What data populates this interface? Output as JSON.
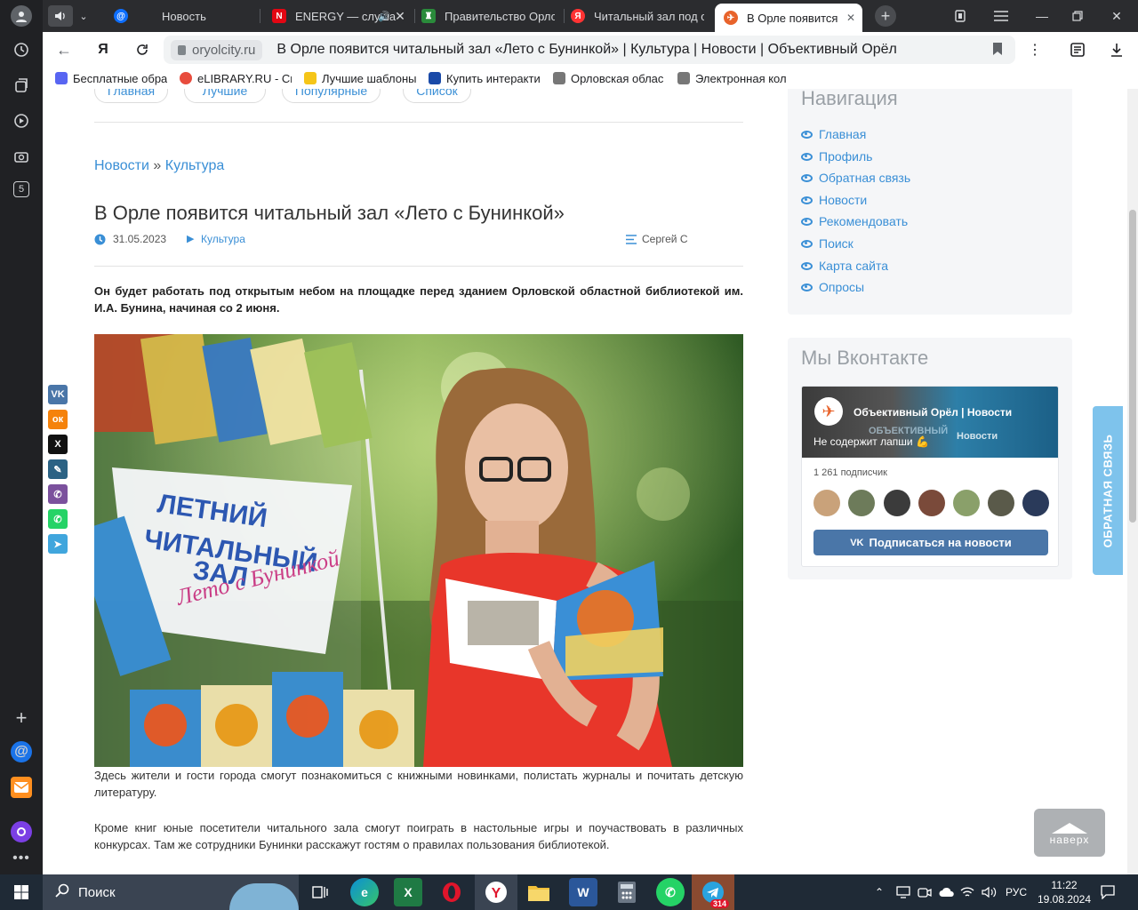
{
  "browser": {
    "tabs": [
      {
        "title": "Новость",
        "favicon_color": "#0d6efd"
      },
      {
        "title": "ENERGY — слуша",
        "favicon_color": "#e30613"
      },
      {
        "title": "Правительство Орло",
        "favicon_color": "#2a8b3b"
      },
      {
        "title": "Читальный зал под от",
        "favicon_color": "#ff3333"
      },
      {
        "title": "В Орле появится ч",
        "favicon_color": "#e8632b",
        "active": true
      }
    ],
    "address": {
      "domain": "oryolcity.ru",
      "title": "В Орле появится читальный зал «Лето с Бунинкой» | Культура | Новости | Объективный Орёл"
    },
    "bookmarks": [
      {
        "label": "Бесплатные обра",
        "color": "#5865f2"
      },
      {
        "label": "eLIBRARY.RU - Св",
        "color": "#e84c3d"
      },
      {
        "label": "Лучшие шаблоны",
        "color": "#f5c518"
      },
      {
        "label": "Купить интеракти",
        "color": "#1a4aa8"
      },
      {
        "label": "Орловская облас",
        "color": "#777777"
      },
      {
        "label": "Электронная кол",
        "color": "#777777"
      }
    ]
  },
  "site": {
    "menu_pills": [
      "Главная",
      "Лучшие",
      "Популярные",
      "Список"
    ],
    "breadcrumb": {
      "first": "Новости",
      "separator": "»",
      "second": "Культура"
    },
    "article": {
      "title": "В Орле появится читальный зал «Лето с Бунинкой»",
      "date": "31.05.2023",
      "category": "Культура",
      "author": "Сергей С",
      "lead": "Он будет работать под открытым небом на площадке перед зданием Орловской областной библиотекой им. И.А. Бунина, начиная со 2 июня.",
      "photo_sign_lines": [
        "ЛЕТНИЙ",
        "ЧИТАЛЬНЫЙ",
        "ЗАЛ",
        "Лето с Бунинкой"
      ],
      "paragraphs": [
        "Здесь жители и гости города смогут познакомиться с книжными новинками, полистать журналы и почитать детскую литературу.",
        "Кроме книг юные посетители читального зала смогут поиграть в настольные игры и поучаствовать в различных конкурсах. Там же сотрудники Бунинки расскажут гостям о правилах пользования библиотекой."
      ]
    },
    "sidebar": {
      "nav_title": "Навигация",
      "nav_items": [
        "Главная",
        "Профиль",
        "Обратная связь",
        "Новости",
        "Рекомендовать",
        "Поиск",
        "Карта сайта",
        "Опросы"
      ],
      "vk_title": "Мы Вконтакте",
      "vk_widget": {
        "group_name": "Объективный Орёл | Новости",
        "status": "Не содержит лапши 💪",
        "cover_text": "ОБЪЕКТИВНЫЙ",
        "cover_sub": "Новости",
        "subscribers": "1 261 подписчик",
        "subscribe_button": "Подписаться на новости"
      }
    },
    "share": [
      {
        "name": "vk",
        "glyph": "VK",
        "color": "#4a76a8"
      },
      {
        "name": "ok",
        "glyph": "ок",
        "color": "#f5820b"
      },
      {
        "name": "x",
        "glyph": "X",
        "color": "#111111"
      },
      {
        "name": "lj",
        "glyph": "✎",
        "color": "#2b6284"
      },
      {
        "name": "viber",
        "glyph": "✆",
        "color": "#7b519d"
      },
      {
        "name": "whatsapp",
        "glyph": "✆",
        "color": "#25d366"
      },
      {
        "name": "telegram",
        "glyph": "➤",
        "color": "#40a6dd"
      }
    ],
    "feedback_tab": "ОБРАТНАЯ СВЯЗЬ",
    "to_top": "наверх"
  },
  "taskbar": {
    "search_placeholder": "Поиск",
    "telegram_badge": "314",
    "lang": "РУС",
    "time": "11:22",
    "date": "19.08.2024"
  },
  "side_panel_badge": "5"
}
